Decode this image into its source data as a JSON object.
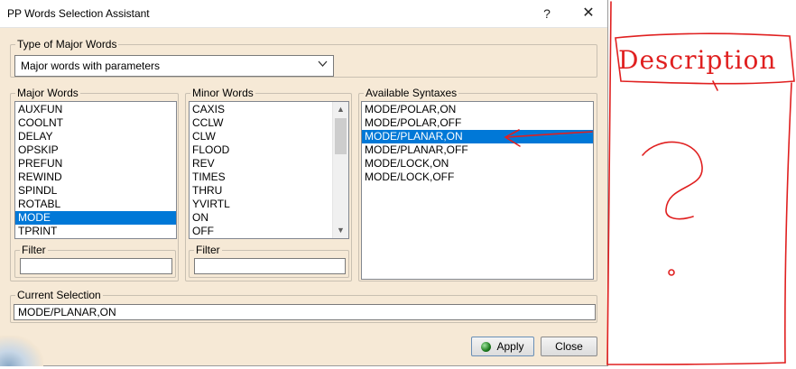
{
  "window": {
    "title": "PP Words Selection Assistant",
    "help_label": "?",
    "close_label": "✕"
  },
  "type_of_major_words": {
    "legend": "Type of Major Words",
    "selected": "Major words with parameters"
  },
  "major_words": {
    "legend": "Major Words",
    "items": [
      "AUXFUN",
      "COOLNT",
      "DELAY",
      "OPSKIP",
      "PREFUN",
      "REWIND",
      "SPINDL",
      "ROTABL",
      "MODE",
      "TPRINT"
    ],
    "selected_index": 8,
    "filter_legend": "Filter",
    "filter_value": ""
  },
  "minor_words": {
    "legend": "Minor Words",
    "items": [
      "CAXIS",
      "CCLW",
      "CLW",
      "FLOOD",
      "REV",
      "TIMES",
      "THRU",
      "YVIRTL",
      "ON",
      "OFF"
    ],
    "filter_legend": "Filter",
    "filter_value": ""
  },
  "available_syntaxes": {
    "legend": "Available Syntaxes",
    "items": [
      "MODE/POLAR,ON",
      "MODE/POLAR,OFF",
      "MODE/PLANAR,ON",
      "MODE/PLANAR,OFF",
      "MODE/LOCK,ON",
      "MODE/LOCK,OFF"
    ],
    "selected_index": 2
  },
  "current_selection": {
    "legend": "Current Selection",
    "value": "MODE/PLANAR,ON"
  },
  "buttons": {
    "apply": "Apply",
    "close": "Close"
  },
  "annotation": {
    "text": "Description",
    "color": "#e02020"
  },
  "icons": {
    "apply": "green-ball-icon",
    "dropdown": "chevron-down-icon",
    "scroll_up": "arrow-up-icon",
    "scroll_down": "arrow-down-icon"
  }
}
